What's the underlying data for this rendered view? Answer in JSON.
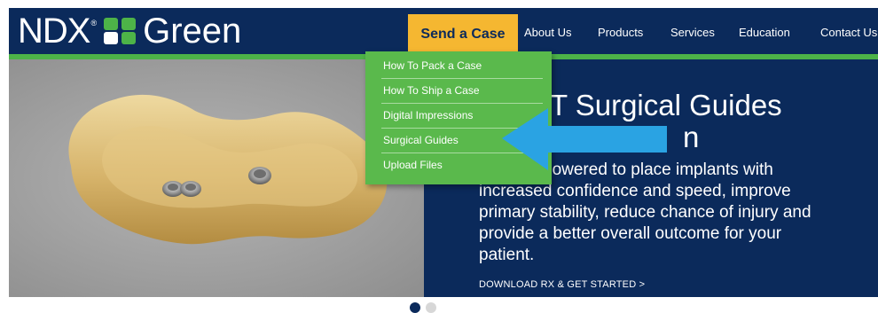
{
  "brand": {
    "name_left": "NDX",
    "registered": "®",
    "name_right": "Green"
  },
  "nav": {
    "send_case": "Send a Case",
    "items": [
      "About Us",
      "Products",
      "Services",
      "Education",
      "Contact Us"
    ]
  },
  "dropdown": {
    "items": [
      "How To Pack a Case",
      "How To Ship a Case",
      "Digital Impressions",
      "Surgical Guides",
      "Upload Files"
    ]
  },
  "hero": {
    "headline_line1": "T Surgical Guides",
    "headline_line2": "n",
    "paragraph_line1": "powered to place implants with",
    "paragraph_line2": "increased confidence and speed, improve",
    "paragraph_line3": "primary stability, reduce chance of injury and",
    "paragraph_line4": "provide a better overall outcome for your",
    "paragraph_line5": "patient.",
    "cta": "DOWNLOAD RX & GET STARTED >"
  },
  "carousel": {
    "active_index": 0,
    "count": 2
  },
  "colors": {
    "navy": "#0b2a5b",
    "green": "#4db348",
    "menu_green": "#5ab94c",
    "gold": "#f5b731",
    "arrow_blue": "#2aa3e3"
  }
}
